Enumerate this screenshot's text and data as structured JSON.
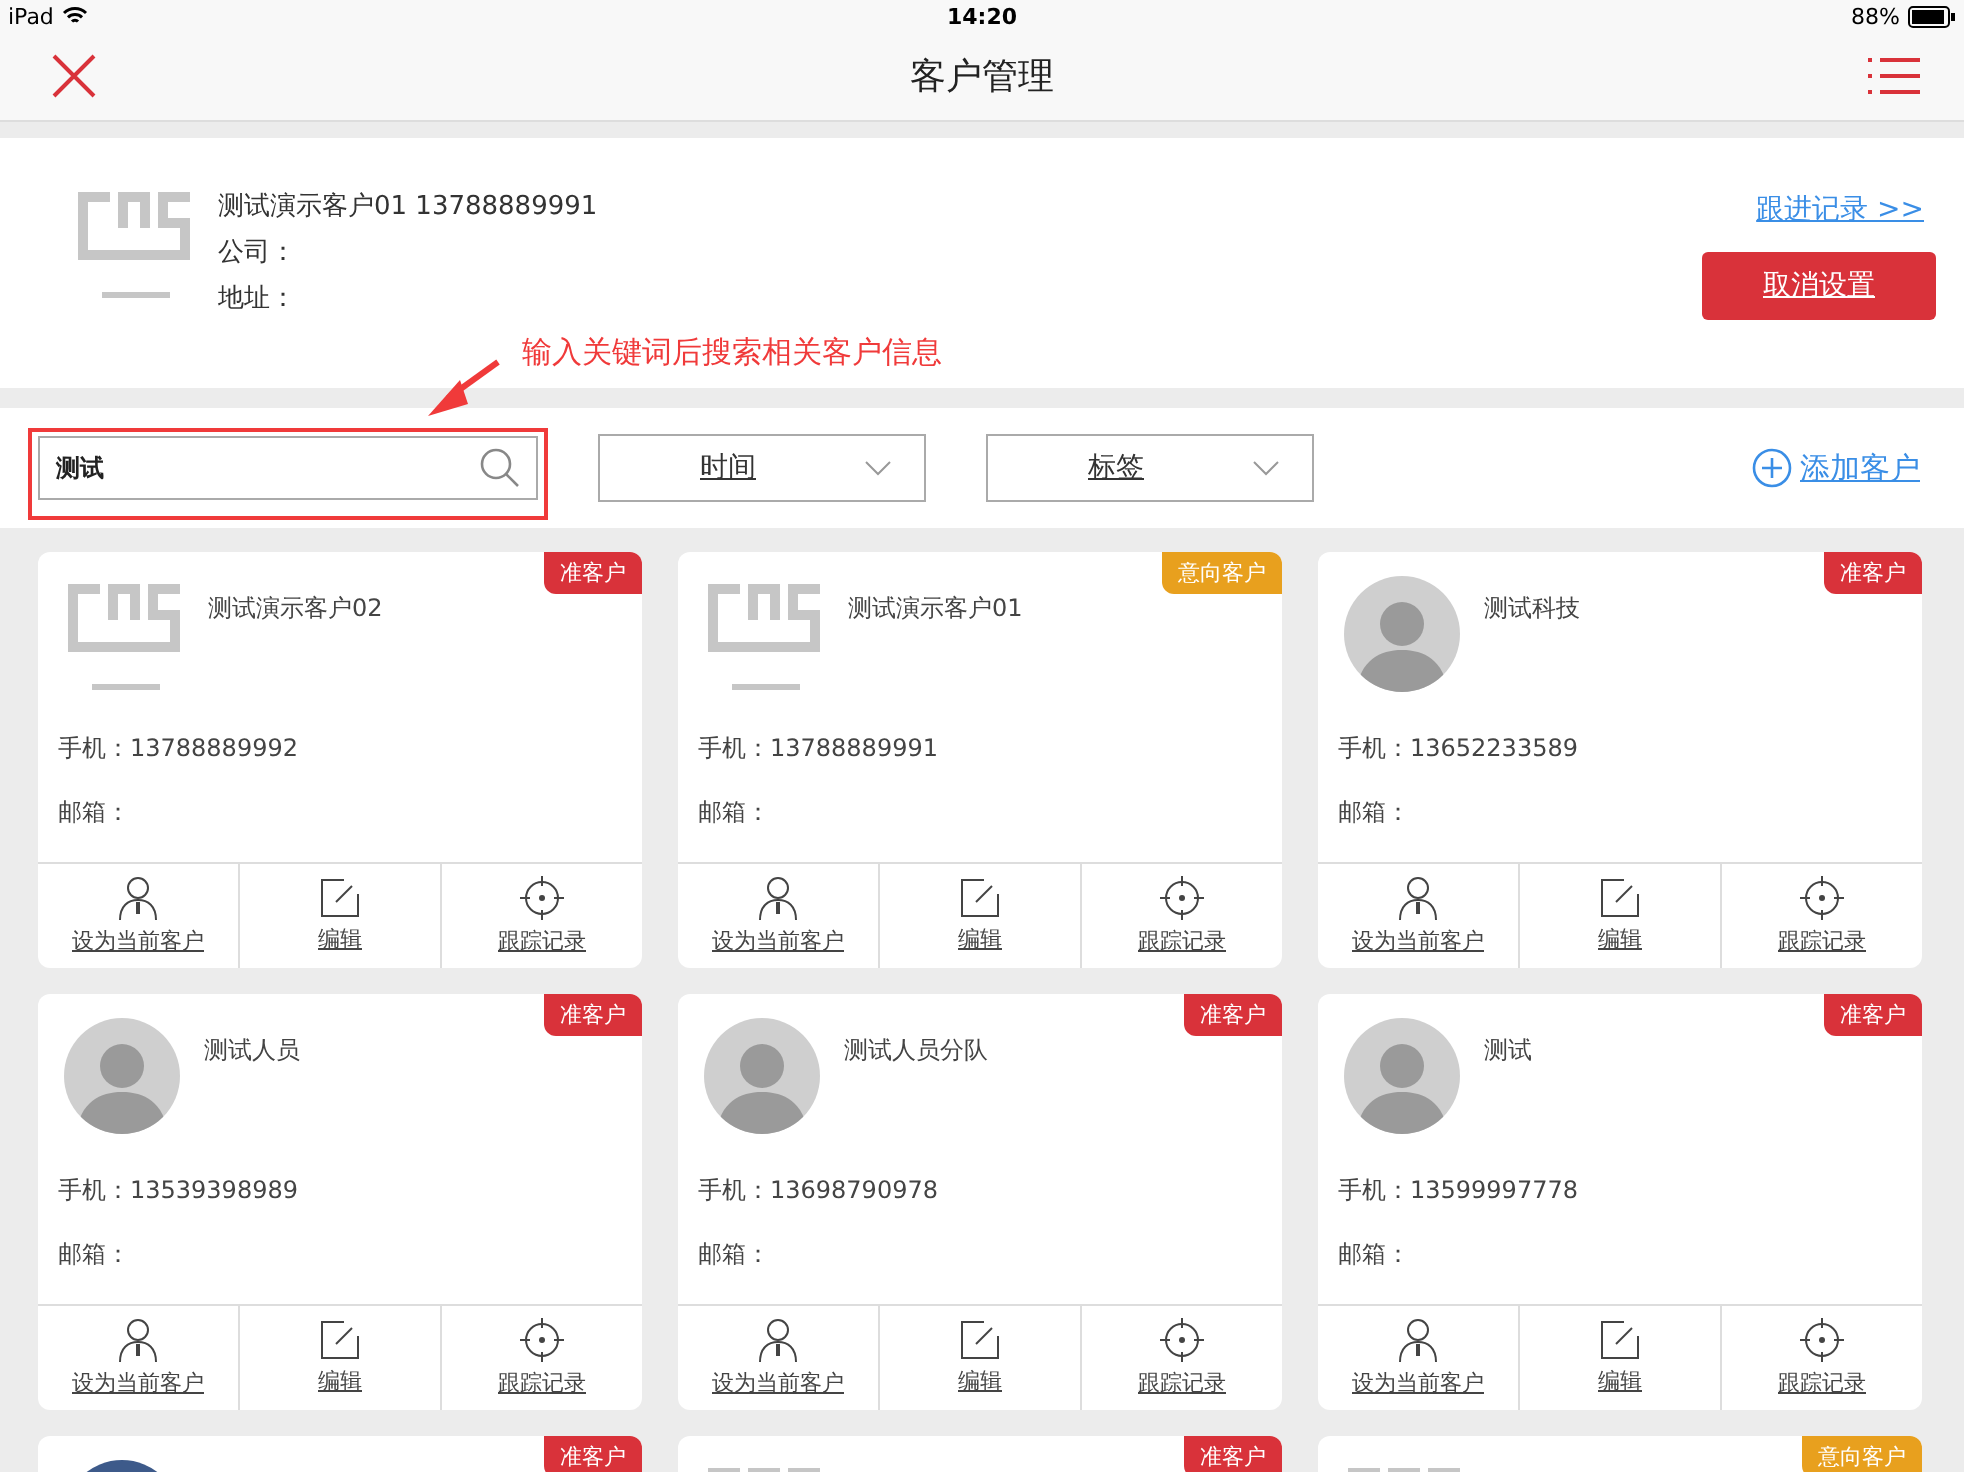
{
  "status_bar": {
    "device": "iPad",
    "time": "14:20",
    "battery": "88%"
  },
  "nav": {
    "title": "客户管理"
  },
  "current_customer": {
    "kind": "logo",
    "name_line": "测试演示客户01  13788889991",
    "company": "公司：",
    "address": "地址：",
    "follow_link": "跟进记录 >>",
    "cancel_button": "取消设置"
  },
  "annotation": {
    "text": "输入关键词后搜索相关客户信息"
  },
  "filters": {
    "search": {
      "value": "测试"
    },
    "dropdowns": [
      {
        "label": "时间"
      },
      {
        "label": "标签"
      }
    ],
    "add_button": "添加客户"
  },
  "customers": [
    {
      "kind": "logo",
      "name": "测试演示客户02",
      "tag": "准客户",
      "color": "#d9323a",
      "phone": "手机：13788889992",
      "email": "邮箱：",
      "actions": [
        "设为当前客户",
        "编辑",
        "跟踪记录"
      ]
    },
    {
      "kind": "logo",
      "name": "测试演示客户01",
      "tag": "意向客户",
      "color": "#e8a01e",
      "phone": "手机：13788889991",
      "email": "邮箱：",
      "actions": [
        "设为当前客户",
        "编辑",
        "跟踪记录"
      ]
    },
    {
      "kind": "person",
      "name": "测试科技",
      "tag": "准客户",
      "color": "#d9323a",
      "phone": "手机：13652233589",
      "email": "邮箱：",
      "actions": [
        "设为当前客户",
        "编辑",
        "跟踪记录"
      ]
    },
    {
      "kind": "person",
      "name": "测试人员",
      "tag": "准客户",
      "color": "#d9323a",
      "phone": "手机：13539398989",
      "email": "邮箱：",
      "actions": [
        "设为当前客户",
        "编辑",
        "跟踪记录"
      ]
    },
    {
      "kind": "person",
      "name": "测试人员分队",
      "tag": "准客户",
      "color": "#d9323a",
      "phone": "手机：13698790978",
      "email": "邮箱：",
      "actions": [
        "设为当前客户",
        "编辑",
        "跟踪记录"
      ]
    },
    {
      "kind": "person",
      "name": "测试",
      "tag": "准客户",
      "color": "#d9323a",
      "phone": "手机：13599997778",
      "email": "邮箱：",
      "actions": [
        "设为当前客户",
        "编辑",
        "跟踪记录"
      ]
    },
    {
      "kind": "photo",
      "tag": "准客户",
      "color": "#d9323a"
    },
    {
      "kind": "logo",
      "tag": "准客户",
      "color": "#d9323a"
    },
    {
      "kind": "logo",
      "tag": "意向客户",
      "color": "#e8a01e"
    }
  ]
}
